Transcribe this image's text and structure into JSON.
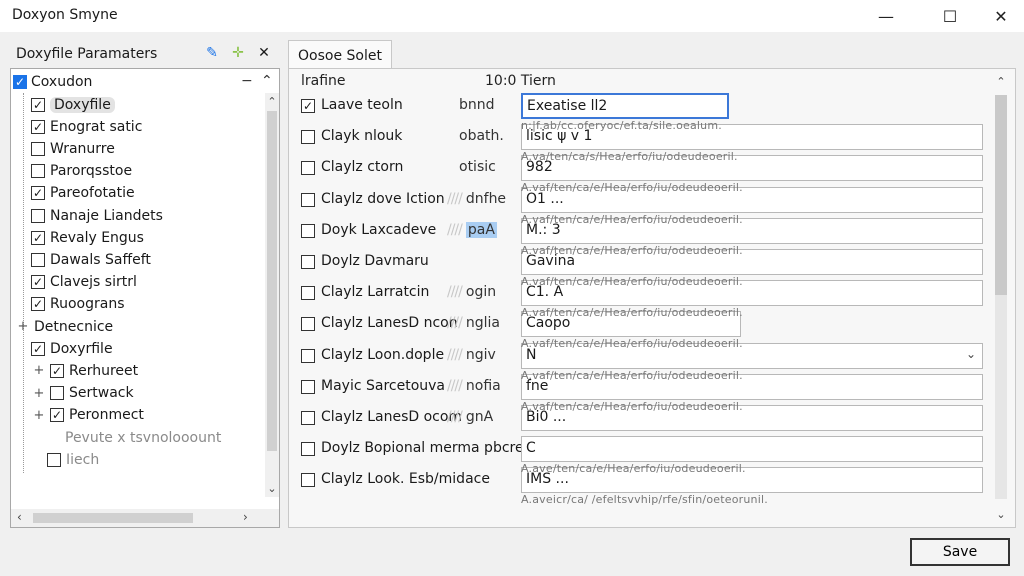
{
  "window": {
    "title": "Doxyon Smyne",
    "minimize": "—",
    "maximize": "☐",
    "close": "✕"
  },
  "left_panel": {
    "title": "Doxyfile Paramaters",
    "root": {
      "label": "Coxudon",
      "checked": true
    },
    "items": [
      {
        "label": "Doxyfile",
        "checked": true,
        "indent": 1,
        "selected": true
      },
      {
        "label": "Enograt satic",
        "checked": true,
        "indent": 1
      },
      {
        "label": "Wranurre",
        "checked": false,
        "indent": 1
      },
      {
        "label": "Parorqsstoe",
        "checked": false,
        "indent": 1
      },
      {
        "label": "Pareofotatie",
        "checked": true,
        "indent": 1
      },
      {
        "label": "Nanaje Liandets",
        "checked": false,
        "indent": 1
      },
      {
        "label": "Revaly Engus",
        "checked": true,
        "indent": 1
      },
      {
        "label": "Dawals Saffeft",
        "checked": false,
        "indent": 1
      },
      {
        "label": "Clavejs sirtrl",
        "checked": true,
        "indent": 1
      },
      {
        "label": "Ruoograns",
        "checked": true,
        "indent": 1
      },
      {
        "label": "Detnecnice",
        "checked": null,
        "indent": 1,
        "expand": "+"
      },
      {
        "label": "Doxyrfile",
        "checked": true,
        "indent": 1
      },
      {
        "label": "Rerhureet",
        "checked": true,
        "indent": 2,
        "expand": "+"
      },
      {
        "label": "Sertwack",
        "checked": false,
        "indent": 2,
        "expand": "+"
      },
      {
        "label": "Peronmect",
        "checked": true,
        "indent": 2,
        "expand": "+"
      },
      {
        "label": "Pevute x tsvnolooount",
        "checked": null,
        "indent": 3,
        "dim": true
      },
      {
        "label": "Iiech",
        "checked": false,
        "indent": 2,
        "dim": true
      }
    ]
  },
  "right_panel": {
    "tab": "Oosoe Solet",
    "header": {
      "col1": "lrafine",
      "col2": "10:0 Tiern"
    },
    "rows": [
      {
        "label": "Laave teoln",
        "mid": "bnnd",
        "value": "Exeatise ll2",
        "checked": true,
        "style": "focused"
      },
      {
        "label": "Clayk nlouk",
        "mid": "obath.",
        "value": "lisic ψ v 1",
        "checked": false
      },
      {
        "label": "Claylz ctorn",
        "mid": "otisic",
        "value": "982",
        "checked": false
      },
      {
        "label": "Claylz dove Iction",
        "mid": "dnfhe",
        "value": "O1 ...",
        "checked": false,
        "ghost": true
      },
      {
        "label": "Doyk Laxcadeve",
        "mid": "paA",
        "value": "M.: 3",
        "checked": false,
        "ghost": true,
        "highlight": true
      },
      {
        "label": "Doylz Davmaru",
        "mid": "",
        "value": "Gavina",
        "checked": false
      },
      {
        "label": "Claylz Larratcin",
        "mid": "ogin",
        "value": "C1. A",
        "checked": false,
        "ghost": true
      },
      {
        "label": "Claylz LanesD ncon",
        "mid": "nglia",
        "value": "Caopo",
        "checked": false,
        "ghost": true,
        "style": "short"
      },
      {
        "label": "Claylz Loon.dople",
        "mid": "ngiv",
        "value": "N",
        "checked": false,
        "ghost": true,
        "style": "dropdown"
      },
      {
        "label": "Mayic Sarcetouva",
        "mid": "nofia",
        "value": "fne",
        "checked": false,
        "ghost": true
      },
      {
        "label": "Claylz LanesD ocom",
        "mid": "gnA",
        "value": "Bi0 ...",
        "checked": false,
        "ghost": true
      },
      {
        "label": "Doylz Bopional merma pbcre",
        "mid": "",
        "value": "C",
        "checked": false
      },
      {
        "label": "Claylz Look. Esb/midace",
        "mid": "",
        "value": "IMS ...",
        "checked": false
      }
    ],
    "hints": [
      "n:|f.ab/cc.oferyoc/ef.ta/sile.oealum.",
      "A.va/ten/ca/s/Hea/erfo/iu/odeudeoeril.",
      "A.vaf/ten/ca/e/Hea/erfo/iu/odeudeoeril.",
      "A.vaf/ten/ca/e/Hea/erfo/iu/odeudeoeril.",
      "A.vaf/ten/ca/e/Hea/erfo/iu/odeudeoeril.",
      "A.vaf/ten/ca/e/Hea/erfo/iu/odeudeoeril.",
      "A.vaf/ten/ca/e/Hea/erfo/iu/odeudeoeril.",
      "A.vaf/ten/ca/e/Hea/erfo/iu/odeudeoeril.",
      "A.vaf/ten/ca/e/Hea/erfo/iu/odeudeoeril.",
      "A.vaf/ten/ca/e/Hea/erfo/iu/odeudeoeril.",
      "A.ave/ten/ca/e/Hea/erfo/iu/odeudeoeril.",
      "A.aveicr/ca/ /efeltsvvhip/rfe/sfin/oeteorunil."
    ]
  },
  "footer": {
    "save_label": "Save"
  },
  "colors": {
    "accent": "#1a73e8",
    "focus_border": "#3c78d8",
    "highlight": "#a9cdf2"
  }
}
